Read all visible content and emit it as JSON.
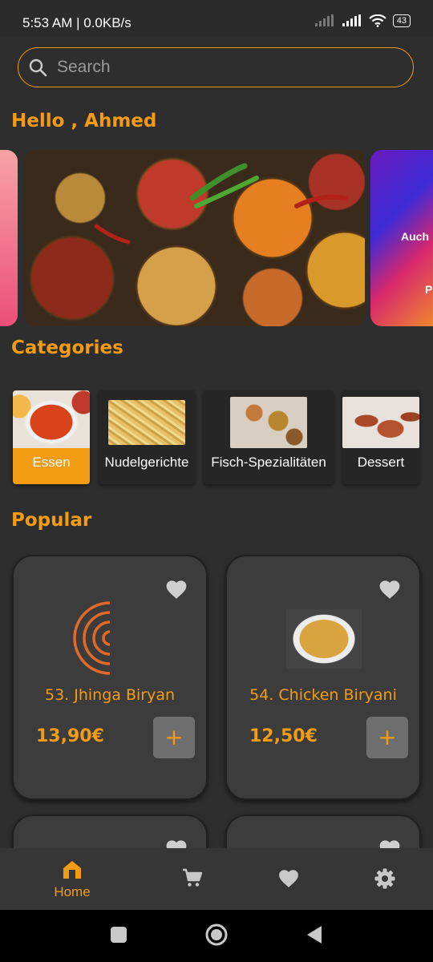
{
  "status_bar": {
    "time": "5:53 AM | 0.0KB/s",
    "battery": "43"
  },
  "search": {
    "placeholder": "Search"
  },
  "greeting": "Hello , Ahmed",
  "banners": {
    "right_text_1": "Auch",
    "right_text_2": "P"
  },
  "categories_title": "Categories",
  "categories": [
    {
      "label": "Essen",
      "active": true
    },
    {
      "label": "Nudelgerichte",
      "active": false
    },
    {
      "label": "Fisch-Spezialitäten",
      "active": false
    },
    {
      "label": "Dessert",
      "active": false
    }
  ],
  "popular_title": "Popular",
  "products": [
    {
      "name": "53. Jhinga Biryan",
      "price": "13,90€",
      "add_label": "+"
    },
    {
      "name": "54. Chicken Biryani",
      "price": "12,50€",
      "add_label": "+"
    }
  ],
  "bottom_nav": [
    {
      "icon": "home-icon",
      "label": "Home",
      "active": true
    },
    {
      "icon": "cart-icon",
      "label": "",
      "active": false
    },
    {
      "icon": "heart-icon",
      "label": "",
      "active": false
    },
    {
      "icon": "settings-icon",
      "label": "",
      "active": false
    }
  ],
  "colors": {
    "accent": "#f39c12",
    "background": "#2e2e2e",
    "card": "#3c3c3c",
    "inactive_icon": "#c8c8c8"
  }
}
